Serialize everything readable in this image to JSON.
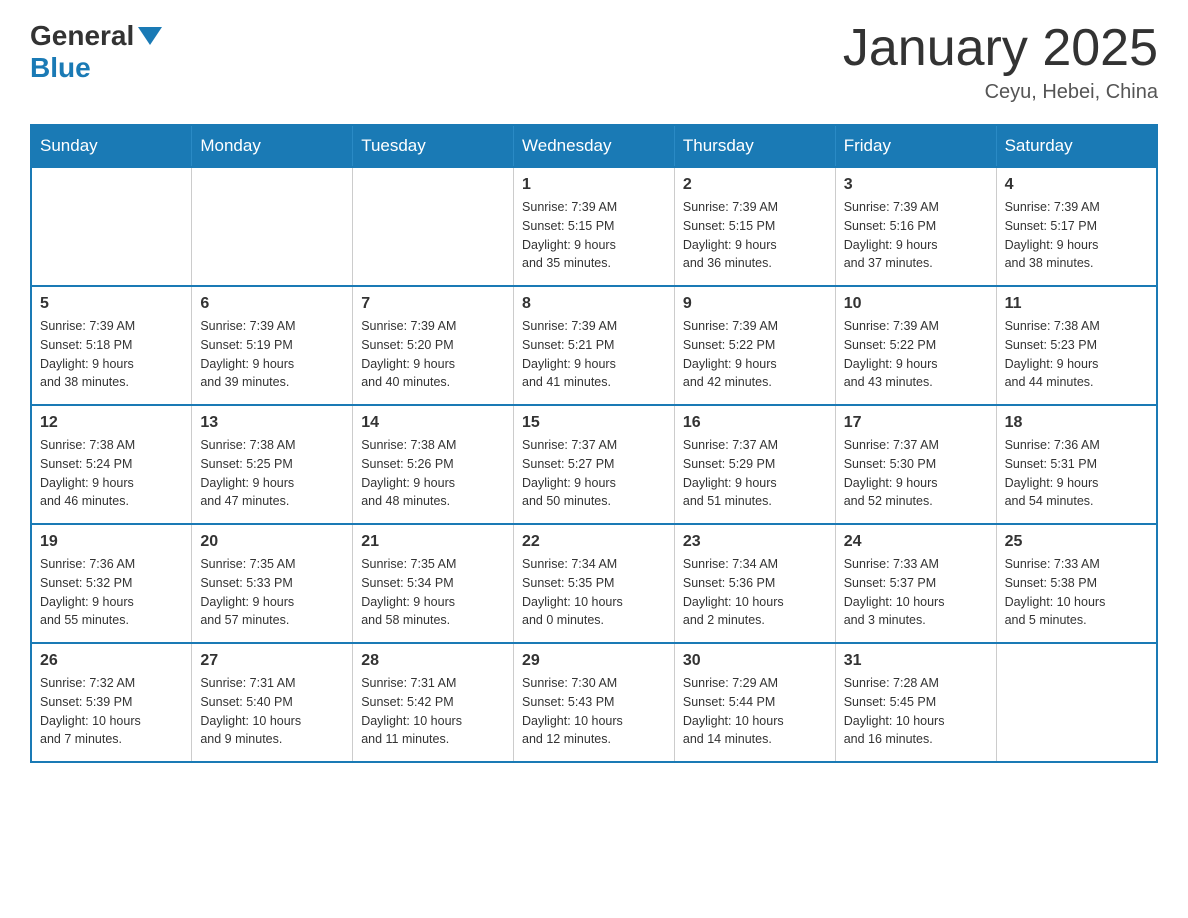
{
  "header": {
    "logo_general": "General",
    "logo_blue": "Blue",
    "month_title": "January 2025",
    "location": "Ceyu, Hebei, China"
  },
  "weekdays": [
    "Sunday",
    "Monday",
    "Tuesday",
    "Wednesday",
    "Thursday",
    "Friday",
    "Saturday"
  ],
  "weeks": [
    [
      {
        "day": "",
        "info": ""
      },
      {
        "day": "",
        "info": ""
      },
      {
        "day": "",
        "info": ""
      },
      {
        "day": "1",
        "info": "Sunrise: 7:39 AM\nSunset: 5:15 PM\nDaylight: 9 hours\nand 35 minutes."
      },
      {
        "day": "2",
        "info": "Sunrise: 7:39 AM\nSunset: 5:15 PM\nDaylight: 9 hours\nand 36 minutes."
      },
      {
        "day": "3",
        "info": "Sunrise: 7:39 AM\nSunset: 5:16 PM\nDaylight: 9 hours\nand 37 minutes."
      },
      {
        "day": "4",
        "info": "Sunrise: 7:39 AM\nSunset: 5:17 PM\nDaylight: 9 hours\nand 38 minutes."
      }
    ],
    [
      {
        "day": "5",
        "info": "Sunrise: 7:39 AM\nSunset: 5:18 PM\nDaylight: 9 hours\nand 38 minutes."
      },
      {
        "day": "6",
        "info": "Sunrise: 7:39 AM\nSunset: 5:19 PM\nDaylight: 9 hours\nand 39 minutes."
      },
      {
        "day": "7",
        "info": "Sunrise: 7:39 AM\nSunset: 5:20 PM\nDaylight: 9 hours\nand 40 minutes."
      },
      {
        "day": "8",
        "info": "Sunrise: 7:39 AM\nSunset: 5:21 PM\nDaylight: 9 hours\nand 41 minutes."
      },
      {
        "day": "9",
        "info": "Sunrise: 7:39 AM\nSunset: 5:22 PM\nDaylight: 9 hours\nand 42 minutes."
      },
      {
        "day": "10",
        "info": "Sunrise: 7:39 AM\nSunset: 5:22 PM\nDaylight: 9 hours\nand 43 minutes."
      },
      {
        "day": "11",
        "info": "Sunrise: 7:38 AM\nSunset: 5:23 PM\nDaylight: 9 hours\nand 44 minutes."
      }
    ],
    [
      {
        "day": "12",
        "info": "Sunrise: 7:38 AM\nSunset: 5:24 PM\nDaylight: 9 hours\nand 46 minutes."
      },
      {
        "day": "13",
        "info": "Sunrise: 7:38 AM\nSunset: 5:25 PM\nDaylight: 9 hours\nand 47 minutes."
      },
      {
        "day": "14",
        "info": "Sunrise: 7:38 AM\nSunset: 5:26 PM\nDaylight: 9 hours\nand 48 minutes."
      },
      {
        "day": "15",
        "info": "Sunrise: 7:37 AM\nSunset: 5:27 PM\nDaylight: 9 hours\nand 50 minutes."
      },
      {
        "day": "16",
        "info": "Sunrise: 7:37 AM\nSunset: 5:29 PM\nDaylight: 9 hours\nand 51 minutes."
      },
      {
        "day": "17",
        "info": "Sunrise: 7:37 AM\nSunset: 5:30 PM\nDaylight: 9 hours\nand 52 minutes."
      },
      {
        "day": "18",
        "info": "Sunrise: 7:36 AM\nSunset: 5:31 PM\nDaylight: 9 hours\nand 54 minutes."
      }
    ],
    [
      {
        "day": "19",
        "info": "Sunrise: 7:36 AM\nSunset: 5:32 PM\nDaylight: 9 hours\nand 55 minutes."
      },
      {
        "day": "20",
        "info": "Sunrise: 7:35 AM\nSunset: 5:33 PM\nDaylight: 9 hours\nand 57 minutes."
      },
      {
        "day": "21",
        "info": "Sunrise: 7:35 AM\nSunset: 5:34 PM\nDaylight: 9 hours\nand 58 minutes."
      },
      {
        "day": "22",
        "info": "Sunrise: 7:34 AM\nSunset: 5:35 PM\nDaylight: 10 hours\nand 0 minutes."
      },
      {
        "day": "23",
        "info": "Sunrise: 7:34 AM\nSunset: 5:36 PM\nDaylight: 10 hours\nand 2 minutes."
      },
      {
        "day": "24",
        "info": "Sunrise: 7:33 AM\nSunset: 5:37 PM\nDaylight: 10 hours\nand 3 minutes."
      },
      {
        "day": "25",
        "info": "Sunrise: 7:33 AM\nSunset: 5:38 PM\nDaylight: 10 hours\nand 5 minutes."
      }
    ],
    [
      {
        "day": "26",
        "info": "Sunrise: 7:32 AM\nSunset: 5:39 PM\nDaylight: 10 hours\nand 7 minutes."
      },
      {
        "day": "27",
        "info": "Sunrise: 7:31 AM\nSunset: 5:40 PM\nDaylight: 10 hours\nand 9 minutes."
      },
      {
        "day": "28",
        "info": "Sunrise: 7:31 AM\nSunset: 5:42 PM\nDaylight: 10 hours\nand 11 minutes."
      },
      {
        "day": "29",
        "info": "Sunrise: 7:30 AM\nSunset: 5:43 PM\nDaylight: 10 hours\nand 12 minutes."
      },
      {
        "day": "30",
        "info": "Sunrise: 7:29 AM\nSunset: 5:44 PM\nDaylight: 10 hours\nand 14 minutes."
      },
      {
        "day": "31",
        "info": "Sunrise: 7:28 AM\nSunset: 5:45 PM\nDaylight: 10 hours\nand 16 minutes."
      },
      {
        "day": "",
        "info": ""
      }
    ]
  ]
}
